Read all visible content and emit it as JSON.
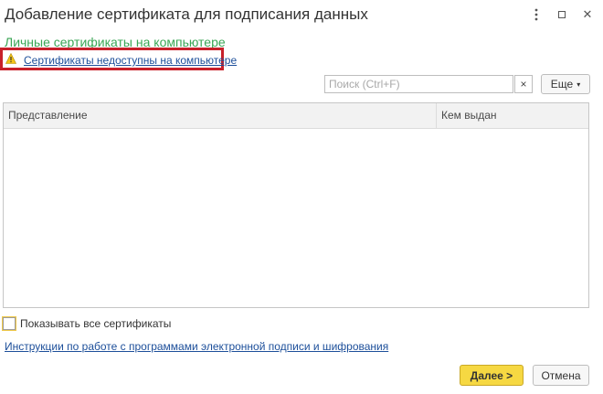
{
  "window": {
    "title": "Добавление сертификата для подписания данных",
    "menu_icon": "kebab-menu-icon",
    "maximize_icon": "maximize-icon",
    "close_label": "✕"
  },
  "section": {
    "title": "Личные сертификаты на компьютере",
    "warning_icon": "warning-triangle-icon",
    "warning_link": "Сертификаты недоступны на компьютере",
    "highlight_color": "#c8202a"
  },
  "toolbar": {
    "search_placeholder": "Поиск (Ctrl+F)",
    "search_value": "",
    "clear_label": "×",
    "more_label": "Еще",
    "more_caret": "▾"
  },
  "table": {
    "columns": [
      "Представление",
      "Кем выдан"
    ],
    "rows": []
  },
  "options": {
    "show_all_label": "Показывать все сертификаты",
    "show_all_checked": false
  },
  "footer": {
    "instructions_link": "Инструкции по работе с программами электронной подписи и шифрования",
    "next_label": "Далее >",
    "cancel_label": "Отмена",
    "accent_color": "#f6d842"
  }
}
